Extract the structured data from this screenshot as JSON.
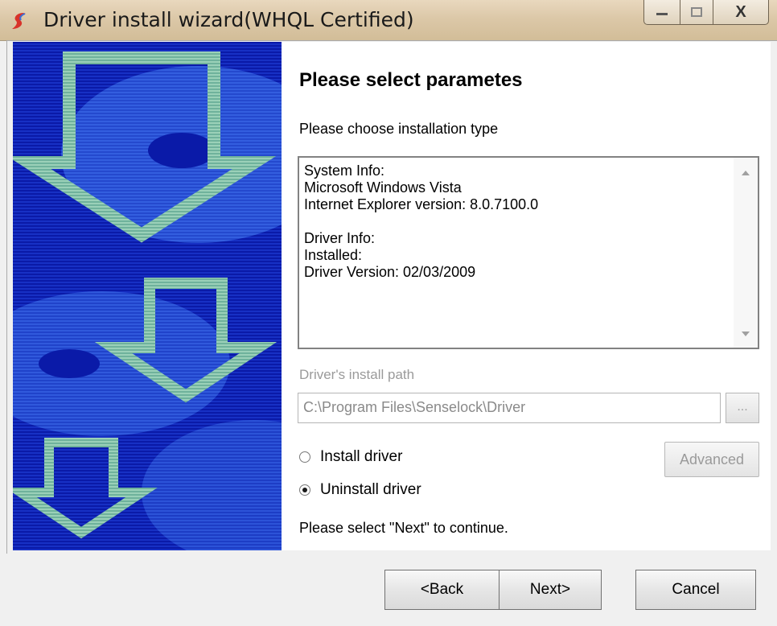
{
  "window": {
    "title": "Driver install wizard(WHQL Certified)",
    "controls": {
      "minimize": "—",
      "maximize": "☐",
      "close": "X"
    }
  },
  "page": {
    "heading": "Please select parametes",
    "subtitle": "Please choose installation type"
  },
  "info_box": {
    "lines": [
      "System Info:",
      "Microsoft Windows Vista",
      "Internet Explorer version: 8.0.7100.0",
      "",
      "Driver Info:",
      "Installed:",
      "Driver Version: 02/03/2009"
    ]
  },
  "install_path": {
    "label": "Driver's install path",
    "value": "C:\\Program Files\\Senselock\\Driver",
    "browse_label": "..."
  },
  "options": {
    "install_label": "Install driver",
    "uninstall_label": "Uninstall driver",
    "selected": "uninstall",
    "advanced_label": "Advanced"
  },
  "footer": {
    "continue_text": "Please select \"Next\" to continue.",
    "back_label": "<Back",
    "next_label": "Next>",
    "cancel_label": "Cancel"
  },
  "colors": {
    "banner_blue": "#1128b8",
    "arrow_green": "#8fc7b0"
  }
}
